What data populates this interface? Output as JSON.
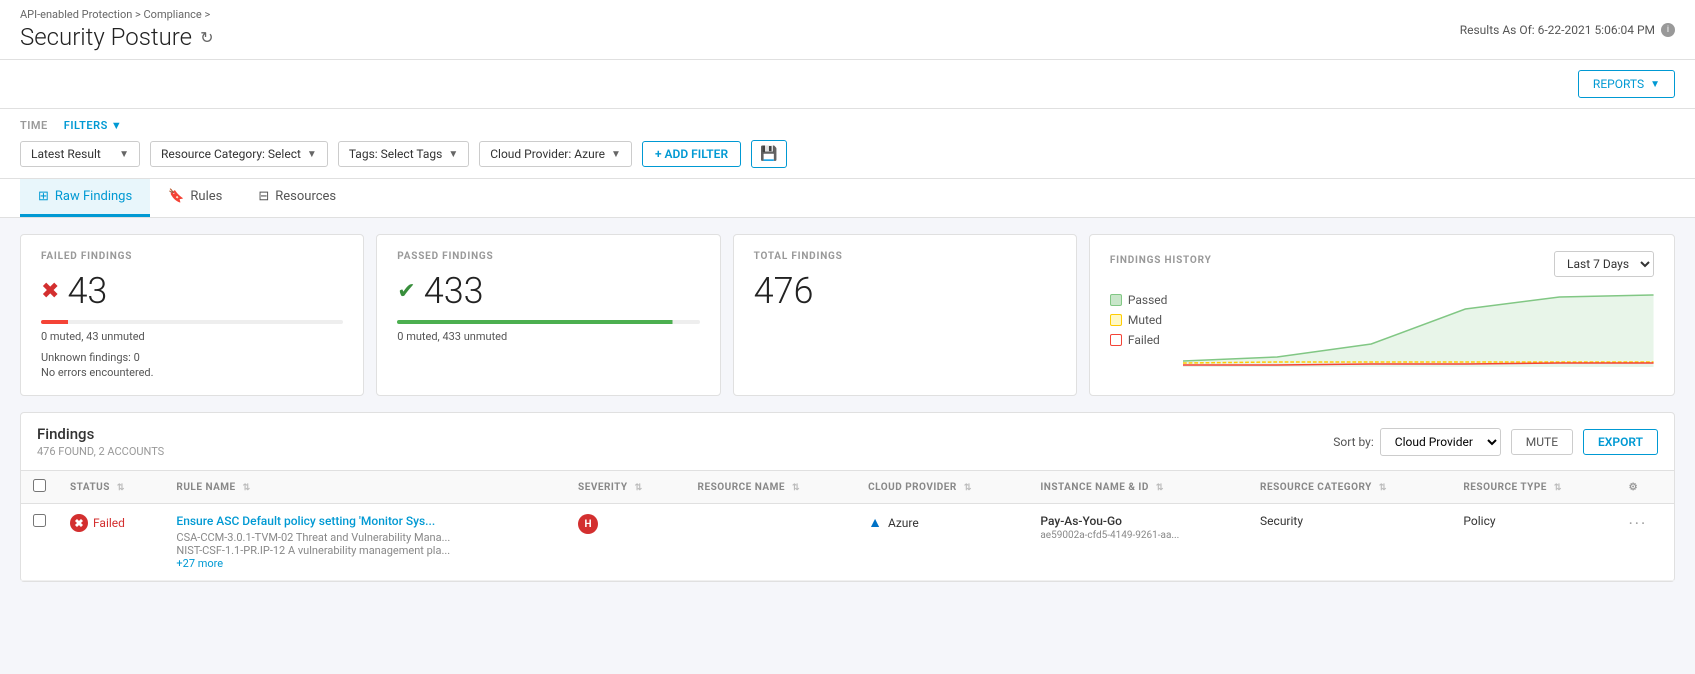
{
  "breadcrumb": "API-enabled Protection > Compliance >",
  "page_title": "Security Posture",
  "results_as_of": "Results As Of: 6-22-2021 5:06:04 PM",
  "toolbar": {
    "reports_label": "REPORTS"
  },
  "filters": {
    "time_label": "TIME",
    "filters_label": "FILTERS",
    "time_select": "Latest Result",
    "resource_category": "Resource Category: Select",
    "tags": "Tags: Select Tags",
    "cloud_provider": "Cloud Provider: Azure",
    "add_filter": "+ ADD FILTER"
  },
  "tabs": [
    {
      "id": "raw-findings",
      "label": "Raw Findings",
      "icon": "grid"
    },
    {
      "id": "rules",
      "label": "Rules",
      "icon": "bookmark"
    },
    {
      "id": "resources",
      "label": "Resources",
      "icon": "server"
    }
  ],
  "metrics": {
    "failed": {
      "label": "FAILED FINDINGS",
      "value": "43",
      "sub1": "0 muted, 43 unmuted",
      "sub2": "Unknown findings: 0",
      "sub3": "No errors encountered."
    },
    "passed": {
      "label": "PASSED FINDINGS",
      "value": "433",
      "sub1": "0 muted, 433 unmuted"
    },
    "total": {
      "label": "TOTAL FINDINGS",
      "value": "476"
    }
  },
  "history": {
    "label": "FINDINGS HISTORY",
    "period": "Last 7 Days",
    "legend": [
      {
        "id": "passed",
        "label": "Passed",
        "color_class": "passed"
      },
      {
        "id": "muted",
        "label": "Muted",
        "color_class": "muted"
      },
      {
        "id": "failed",
        "label": "Failed",
        "color_class": "failed"
      }
    ]
  },
  "findings_table": {
    "title": "Findings",
    "subtitle": "476 FOUND, 2 ACCOUNTS",
    "sort_by_label": "Sort by:",
    "sort_by_value": "Cloud Provider",
    "mute_label": "MUTE",
    "export_label": "EXPORT",
    "columns": [
      {
        "id": "status",
        "label": "STATUS"
      },
      {
        "id": "rule_name",
        "label": "RULE NAME"
      },
      {
        "id": "severity",
        "label": "SEVERITY"
      },
      {
        "id": "resource_name",
        "label": "RESOURCE NAME"
      },
      {
        "id": "cloud_provider",
        "label": "CLOUD PROVIDER"
      },
      {
        "id": "instance_name",
        "label": "INSTANCE NAME & ID"
      },
      {
        "id": "resource_category",
        "label": "RESOURCE CATEGORY"
      },
      {
        "id": "resource_type",
        "label": "RESOURCE TYPE"
      }
    ],
    "rows": [
      {
        "status": "Failed",
        "rule_name": "Ensure ASC Default policy setting 'Monitor Sys...",
        "rule_sub1": "CSA-CCM-3.0.1-TVM-02 Threat and Vulnerability Mana...",
        "rule_sub2": "NIST-CSF-1.1-PR.IP-12 A vulnerability management pla...",
        "rule_more": "+27 more",
        "severity": "H",
        "resource_name": "",
        "cloud_provider": "Azure",
        "instance_name": "Pay-As-You-Go",
        "instance_id": "ae59002a-cfd5-4149-9261-aa...",
        "resource_category": "Security",
        "resource_type": "Policy"
      }
    ]
  }
}
